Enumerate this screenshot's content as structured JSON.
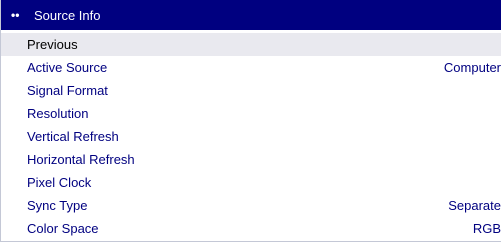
{
  "header": {
    "dots": "••",
    "title": "Source Info"
  },
  "rows": [
    {
      "label": "Previous",
      "value": ""
    },
    {
      "label": "Active Source",
      "value": "Computer"
    },
    {
      "label": "Signal Format",
      "value": ""
    },
    {
      "label": "Resolution",
      "value": ""
    },
    {
      "label": "Vertical Refresh",
      "value": ""
    },
    {
      "label": "Horizontal Refresh",
      "value": ""
    },
    {
      "label": "Pixel Clock",
      "value": ""
    },
    {
      "label": "Sync Type",
      "value": "Separate"
    },
    {
      "label": "Color Space",
      "value": "RGB"
    }
  ],
  "colors": {
    "title_bar": "#000080",
    "text": "#000080",
    "highlight_row": "#e9e9ef"
  }
}
